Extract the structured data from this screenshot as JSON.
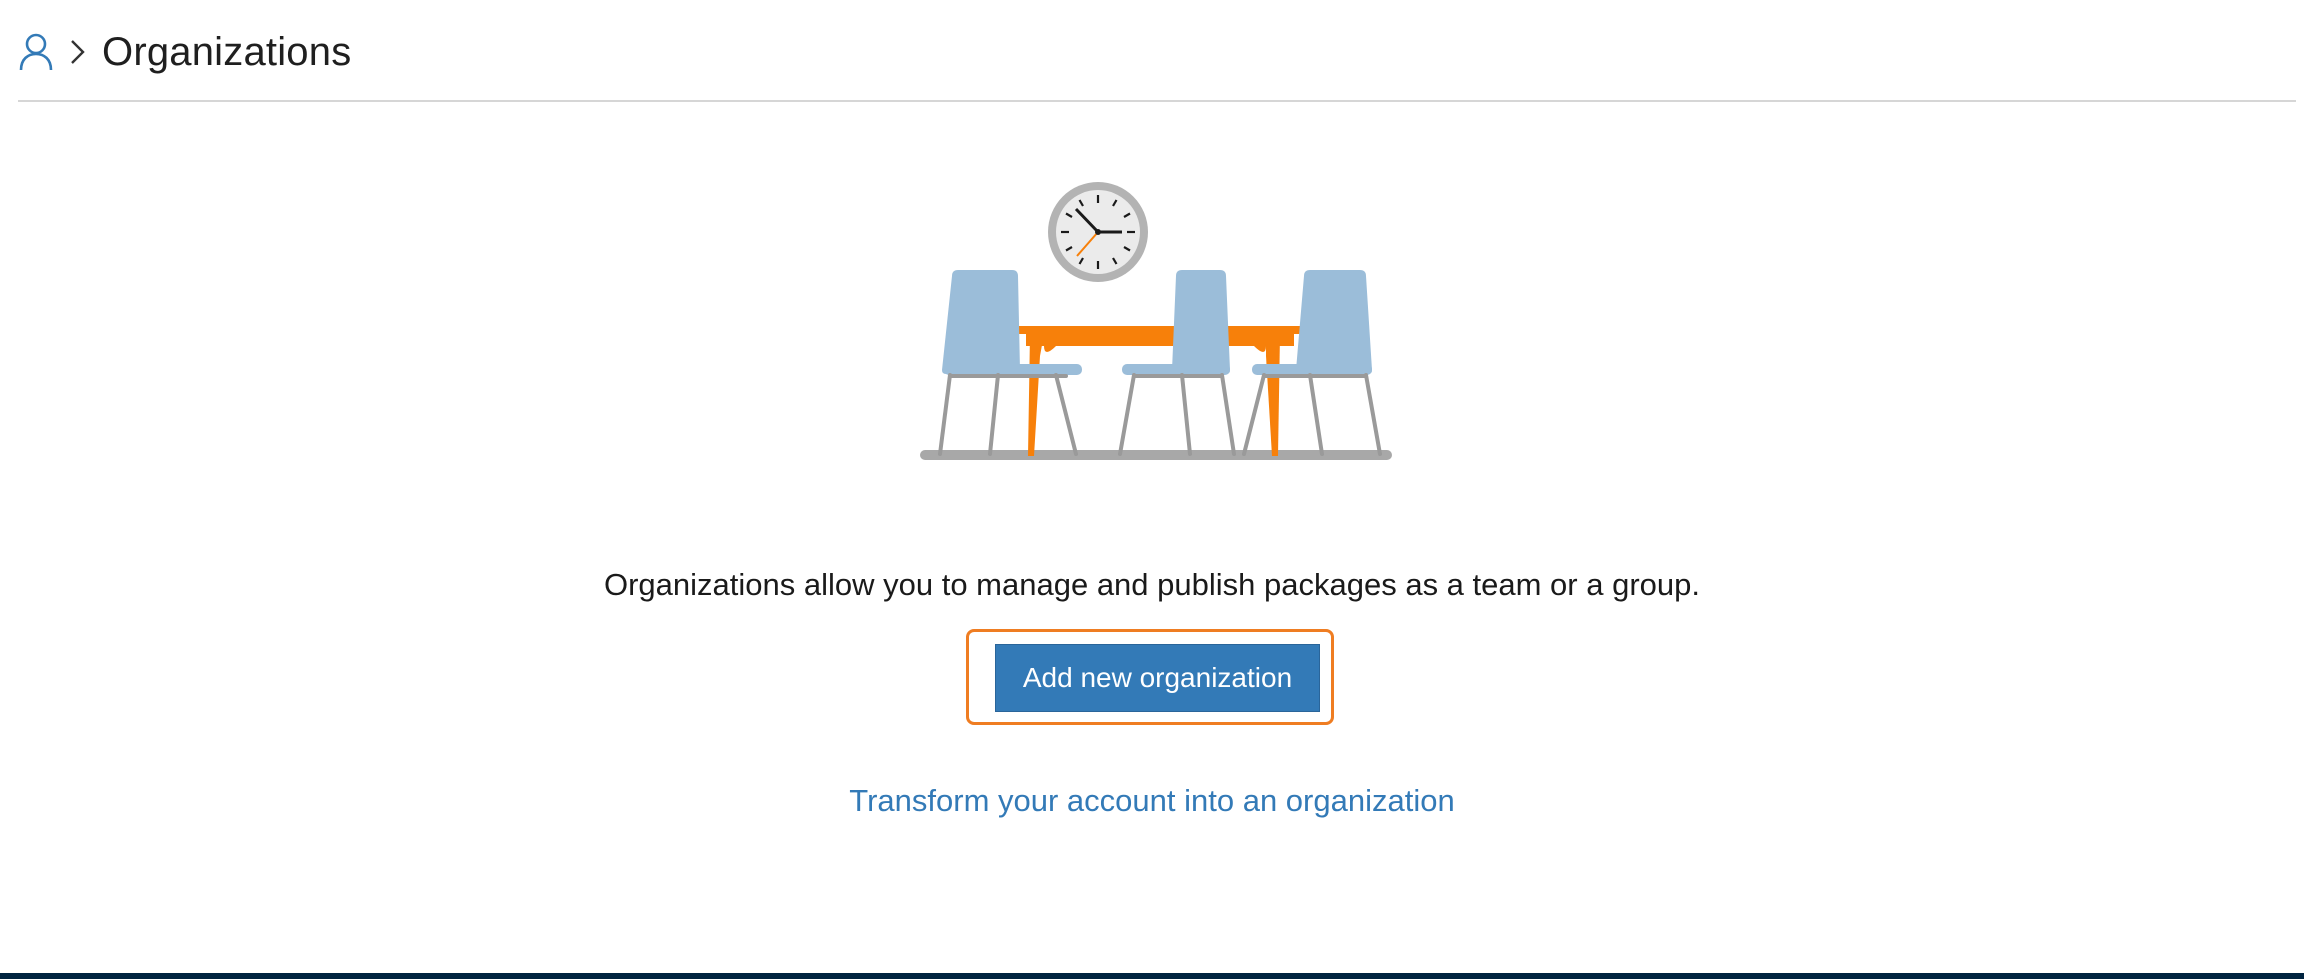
{
  "breadcrumb": {
    "root_icon": "user-icon",
    "separator_icon": "chevron-right-icon",
    "title": "Organizations"
  },
  "illustration": {
    "icon": "meeting-room-illustration"
  },
  "main": {
    "description": "Organizations allow you to manage and publish packages as a team or a group.",
    "add_button_label": "Add new organization",
    "transform_link_text": "Transform your account into an organization"
  },
  "colors": {
    "accent": "#337ab7",
    "focus_ring": "#ef7d22",
    "table": "#f7800a",
    "chair": "#9bbdd9",
    "footer": "#002440"
  }
}
